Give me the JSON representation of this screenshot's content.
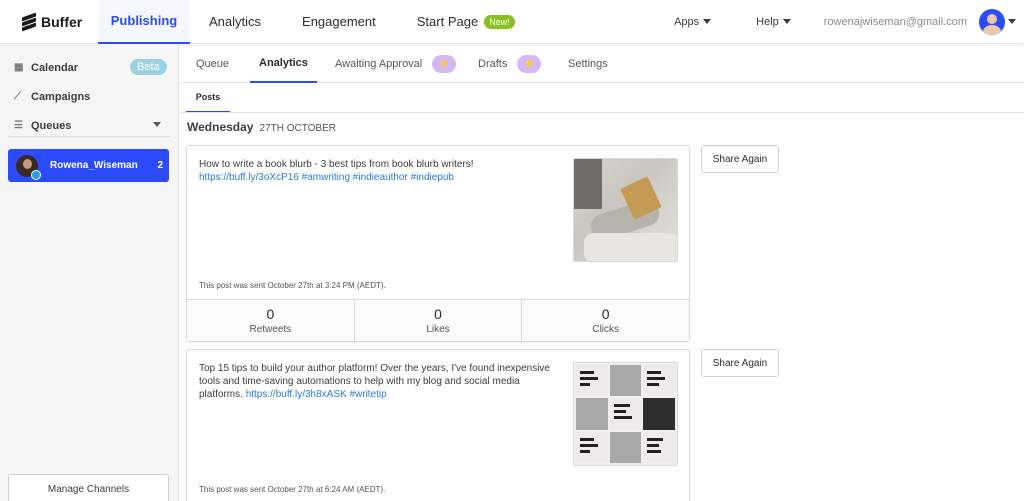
{
  "app": {
    "logo": "Buffer"
  },
  "topnav": {
    "tabs": [
      "Publishing",
      "Analytics",
      "Engagement",
      "Start Page"
    ],
    "new_badge": "New!",
    "apps": "Apps",
    "help": "Help",
    "email": "rowenajwiseman@gmail.com"
  },
  "sidebar": {
    "calendar": "Calendar",
    "beta": "Beta",
    "campaigns": "Campaigns",
    "queues": "Queues",
    "channel": {
      "name": "Rowena_Wiseman",
      "count": "2"
    },
    "manage": "Manage Channels"
  },
  "subnav": {
    "tabs": [
      "Queue",
      "Analytics",
      "Awaiting Approval",
      "Drafts",
      "Settings"
    ],
    "posts": "Posts"
  },
  "day": {
    "name": "Wednesday",
    "date": "27TH OCTOBER"
  },
  "posts": [
    {
      "text": "How to write a book blurb -  3 best tips from book blurb writers!",
      "link": "https://buff.ly/3oXcP16 #amwriting #indieauthor #indiepub",
      "sent": "This post was sent October 27th at 3:24 PM (AEDT).",
      "stats": [
        {
          "value": "0",
          "label": "Retweets"
        },
        {
          "value": "0",
          "label": "Likes"
        },
        {
          "value": "0",
          "label": "Clicks"
        }
      ],
      "share": "Share Again"
    },
    {
      "text": "Top 15 tips to build your author platform! Over the years, I've found inexpensive tools and time-saving automations to help with my blog and social media platforms.",
      "link": "https://buff.ly/3h8xASK #writetip",
      "sent": "This post was sent October 27th at 6:24 AM (AEDT).",
      "share": "Share Again"
    }
  ]
}
